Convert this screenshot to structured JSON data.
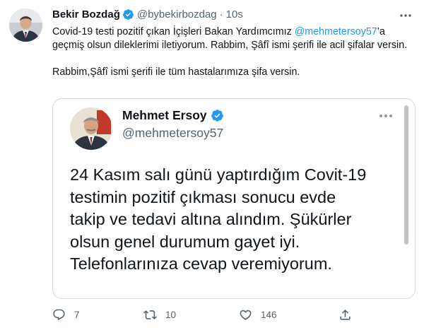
{
  "author": {
    "name": "Bekir Bozdağ",
    "handle": "@bybekirbozdag",
    "separator": "·",
    "time": "10s"
  },
  "tweet_text": {
    "line1_before": "Covid-19 testi pozitif çıkan İçişleri Bakan Yardımcımız ",
    "mention": "@mehmetersoy57",
    "line1_after": "’a geçmiş olsun dileklerimi iletiyorum. Rabbim, Şâfî ismi şerifi ile acil şifalar versin.",
    "paragraph2": "Rabbim,Şâfî ismi şerifi ile tüm hastalarımıza şifa versin."
  },
  "quoted": {
    "name": "Mehmet Ersoy",
    "handle": "@mehmetersoy57",
    "lines": [
      "24 Kasım salı günü yaptırdığım Covit-19",
      "testimin pozitif çıkması sonucu evde",
      "takip ve tedavi altına alındım. Şükürler",
      "olsun genel durumum gayet iyi.",
      "Telefonlarınıza cevap veremiyorum."
    ]
  },
  "actions": {
    "reply_count": "7",
    "retweet_count": "10",
    "like_count": "146"
  },
  "icons": {
    "verified": "verified-badge-icon",
    "more": "more-dots-icon",
    "reply": "reply-icon",
    "retweet": "retweet-icon",
    "like": "heart-icon",
    "share": "share-icon"
  },
  "colors": {
    "accent": "#1d9bf0",
    "text": "#0f1419",
    "muted": "#536471",
    "border": "#cfd9de"
  }
}
